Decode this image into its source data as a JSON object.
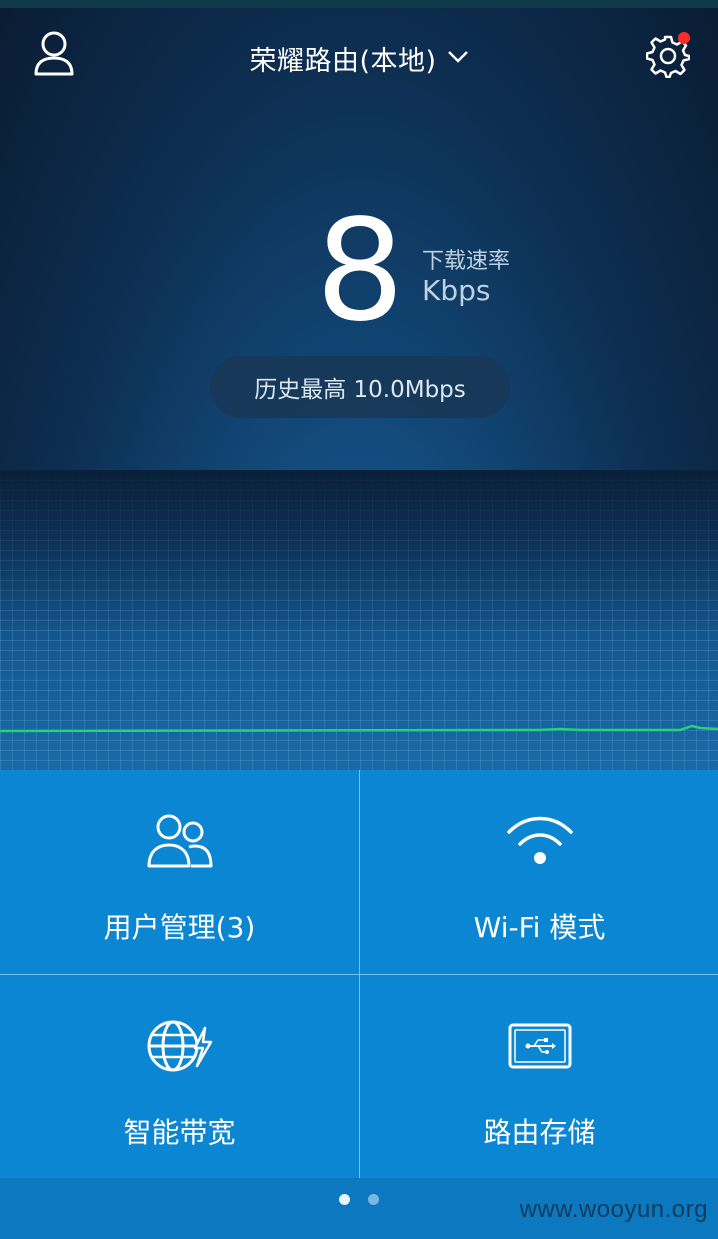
{
  "header": {
    "title": "荣耀路由(本地)",
    "user_icon": "user-icon",
    "settings_icon": "gear-icon",
    "notification_dot_color": "#ff2a2a"
  },
  "speed": {
    "value": "8",
    "label": "下载速率",
    "unit": "Kbps"
  },
  "history": {
    "text": "历史最高 10.0Mbps"
  },
  "tiles": [
    {
      "label": "用户管理(3)",
      "icon": "users-icon"
    },
    {
      "label": "Wi-Fi 模式",
      "icon": "wifi-icon"
    },
    {
      "label": "智能带宽",
      "icon": "globe-bolt-icon"
    },
    {
      "label": "路由存储",
      "icon": "usb-storage-icon"
    }
  ],
  "pager": {
    "pages": 2,
    "active": 1
  },
  "watermark": "www.wooyun.org",
  "colors": {
    "tile_bg": "#0a86d3",
    "traffic_line": "#21d47a",
    "accent_red": "#ff2a2a"
  }
}
